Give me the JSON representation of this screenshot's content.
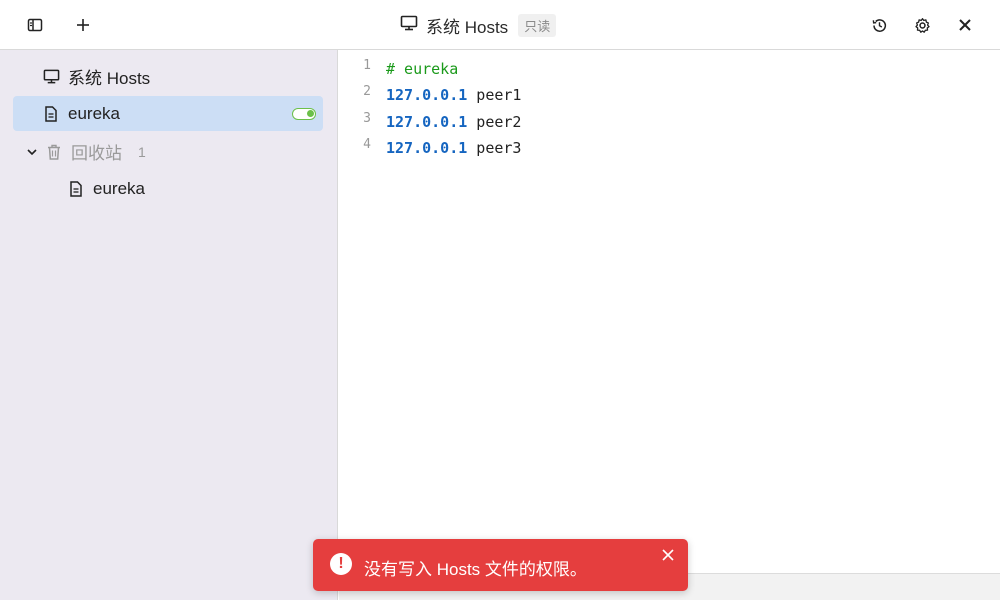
{
  "header": {
    "title": "系统 Hosts",
    "readonly_badge": "只读"
  },
  "icons": {
    "sidebar_toggle": "sidebar-panel-icon",
    "add": "plus-icon",
    "title": "monitor-icon",
    "history": "history-icon",
    "settings": "gear-icon",
    "close": "close-icon"
  },
  "sidebar": {
    "items": [
      {
        "label": "系统 Hosts",
        "icon": "monitor-icon"
      },
      {
        "label": "eureka",
        "icon": "document-icon",
        "selected": true,
        "enabled": true
      },
      {
        "label": "回收站",
        "icon": "trash-icon",
        "count": "1",
        "expanded": true
      },
      {
        "label": "eureka",
        "icon": "document-icon"
      }
    ]
  },
  "editor": {
    "lines": [
      {
        "number": "1",
        "comment": "# eureka"
      },
      {
        "number": "2",
        "ip": "127.0.0.1",
        "host": " peer1"
      },
      {
        "number": "3",
        "ip": "127.0.0.1",
        "host": " peer2"
      },
      {
        "number": "4",
        "ip": "127.0.0.1",
        "host": " peer3"
      }
    ]
  },
  "toast": {
    "message": "没有写入 Hosts 文件的权限。",
    "icon": "exclamation-circle-icon"
  },
  "colors": {
    "accent_selected": "#ccdef5",
    "sidebar_bg": "#ece9f1",
    "toggle_on": "#6cc04a",
    "comment": "#1b9a1b",
    "ip": "#1565c0",
    "toast_bg": "#e53e3e"
  }
}
